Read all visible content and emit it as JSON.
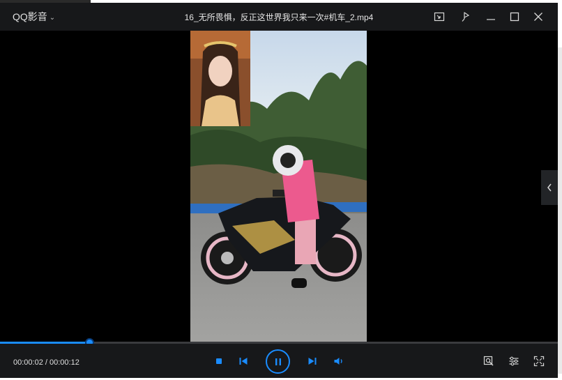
{
  "app": {
    "brand": "QQ影音"
  },
  "window": {
    "title": "16_无所畏惧，反正这世界我只来一次#机车_2.mp4"
  },
  "player": {
    "time_display": "00:00:02 / 00:00:12",
    "progress_fraction": 0.16,
    "state": "playing"
  },
  "icons": {
    "brand_menu": "chevron-down-icon",
    "mini_mode": "mini-mode-icon",
    "pin": "pin-icon",
    "minimize": "minimize-icon",
    "maximize": "maximize-icon",
    "close": "close-icon",
    "side_panel": "chevron-left-icon",
    "stop": "stop-icon",
    "previous": "previous-icon",
    "pause": "pause-icon",
    "next": "next-icon",
    "volume": "volume-icon",
    "screenshot": "screenshot-icon",
    "settings": "settings-icon",
    "fullscreen": "fullscreen-icon"
  },
  "colors": {
    "accent": "#1a8cff",
    "chrome": "#17181a",
    "video_bg": "#000000"
  }
}
